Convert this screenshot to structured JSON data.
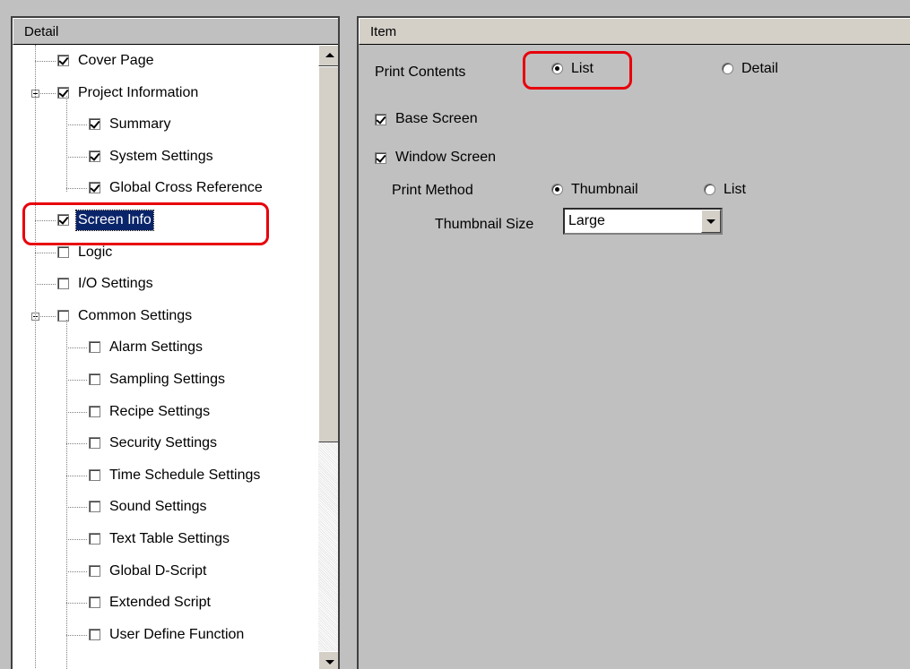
{
  "left_panel": {
    "header": "Detail",
    "tree": [
      {
        "label": "Cover Page",
        "checked": true,
        "level": 0
      },
      {
        "label": "Project Information",
        "checked": true,
        "level": 0,
        "expanded": true
      },
      {
        "label": "Summary",
        "checked": true,
        "level": 1
      },
      {
        "label": "System Settings",
        "checked": true,
        "level": 1
      },
      {
        "label": "Global Cross Reference",
        "checked": true,
        "level": 1
      },
      {
        "label": "Screen Info",
        "checked": true,
        "level": 0,
        "selected": true
      },
      {
        "label": "Logic",
        "checked": false,
        "level": 0
      },
      {
        "label": "I/O Settings",
        "checked": false,
        "level": 0
      },
      {
        "label": "Common Settings",
        "checked": false,
        "level": 0,
        "expanded": true
      },
      {
        "label": "Alarm Settings",
        "checked": false,
        "level": 1
      },
      {
        "label": "Sampling Settings",
        "checked": false,
        "level": 1
      },
      {
        "label": "Recipe Settings",
        "checked": false,
        "level": 1
      },
      {
        "label": "Security Settings",
        "checked": false,
        "level": 1
      },
      {
        "label": "Time Schedule Settings",
        "checked": false,
        "level": 1
      },
      {
        "label": "Sound Settings",
        "checked": false,
        "level": 1
      },
      {
        "label": "Text Table Settings",
        "checked": false,
        "level": 1
      },
      {
        "label": "Global D-Script",
        "checked": false,
        "level": 1
      },
      {
        "label": "Extended Script",
        "checked": false,
        "level": 1
      },
      {
        "label": "User Define Function",
        "checked": false,
        "level": 1
      }
    ]
  },
  "right_panel": {
    "header": "Item",
    "print_contents_label": "Print Contents",
    "print_contents_options": [
      "List",
      "Detail"
    ],
    "print_contents_selected": "List",
    "base_screen_label": "Base Screen",
    "base_screen_checked": true,
    "window_screen_label": "Window Screen",
    "window_screen_checked": true,
    "print_method_label": "Print Method",
    "print_method_options": [
      "Thumbnail",
      "List"
    ],
    "print_method_selected": "Thumbnail",
    "thumbnail_size_label": "Thumbnail Size",
    "thumbnail_size_value": "Large"
  },
  "colors": {
    "highlight": "#e8000b",
    "selection": "#0a246a",
    "panel_bg": "#c0c0c0"
  }
}
